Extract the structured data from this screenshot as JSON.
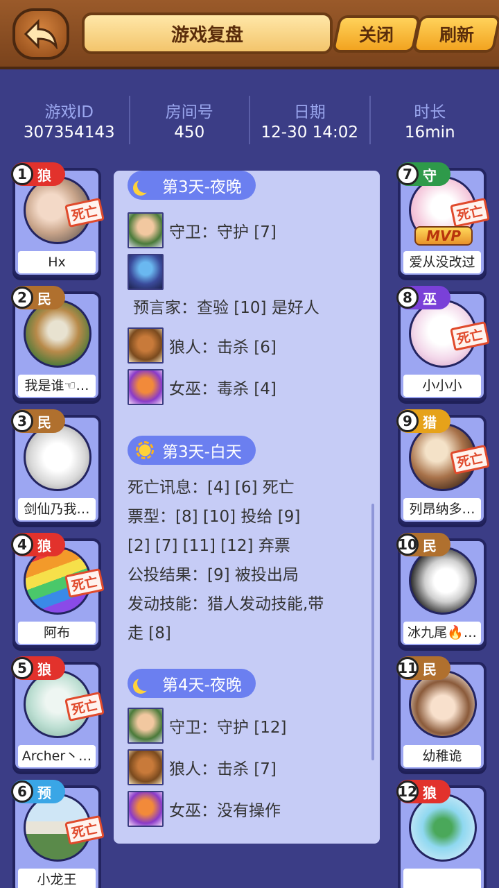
{
  "header": {
    "title": "游戏复盘",
    "close_label": "关闭",
    "refresh_label": "刷新"
  },
  "info": [
    {
      "label": "游戏ID",
      "value": "307354143"
    },
    {
      "label": "房间号",
      "value": "450"
    },
    {
      "label": "日期",
      "value": "12-30 14:02"
    },
    {
      "label": "时长",
      "value": "16min"
    }
  ],
  "players": [
    {
      "num": "1",
      "role": "狼",
      "name": "Hx",
      "dead": true
    },
    {
      "num": "2",
      "role": "民",
      "name": "我是谁☜…",
      "dead": false
    },
    {
      "num": "3",
      "role": "民",
      "name": "剑仙乃我…",
      "dead": false
    },
    {
      "num": "4",
      "role": "狼",
      "name": "阿布",
      "dead": true
    },
    {
      "num": "5",
      "role": "狼",
      "name": "Archer丶…",
      "dead": true
    },
    {
      "num": "6",
      "role": "预",
      "name": "小龙王",
      "dead": true
    },
    {
      "num": "7",
      "role": "守",
      "name": "爱从没改过",
      "dead": true,
      "mvp": true
    },
    {
      "num": "8",
      "role": "巫",
      "name": "小小小",
      "dead": true
    },
    {
      "num": "9",
      "role": "猎",
      "name": "列昂纳多…",
      "dead": true
    },
    {
      "num": "10",
      "role": "民",
      "name": "冰九尾🔥…",
      "dead": false
    },
    {
      "num": "11",
      "role": "民",
      "name": "幼稚诡",
      "dead": false
    },
    {
      "num": "12",
      "role": "狼",
      "name": "",
      "dead": false
    }
  ],
  "labels": {
    "death": "死亡",
    "mvp": "MVP"
  },
  "log": {
    "night3": {
      "phase": "第3天-夜晚",
      "guard": "守卫：守护 [7]",
      "seer": "预言家：查验 [10] 是好人",
      "wolf": "狼人：击杀 [6]",
      "witch": "女巫：毒杀 [4]"
    },
    "day3": {
      "phase": "第3天-白天",
      "lines": [
        "死亡讯息：[4] [6] 死亡",
        "票型：[8] [10] 投给 [9]",
        "[2] [7] [11] [12] 弃票",
        "公投结果：[9] 被投出局",
        "发动技能：猎人发动技能,带",
        "走 [8]"
      ]
    },
    "night4": {
      "phase": "第4天-夜晚",
      "guard": "守卫：守护 [12]",
      "wolf": "狼人：击杀 [7]",
      "witch": "女巫：没有操作"
    }
  },
  "colors": {
    "wolf": "#e2322c",
    "villager": "#b0702e",
    "seer": "#3aa6e6",
    "guard": "#2e9a4a",
    "witch": "#7a40d8",
    "hunter": "#e6a21a"
  }
}
